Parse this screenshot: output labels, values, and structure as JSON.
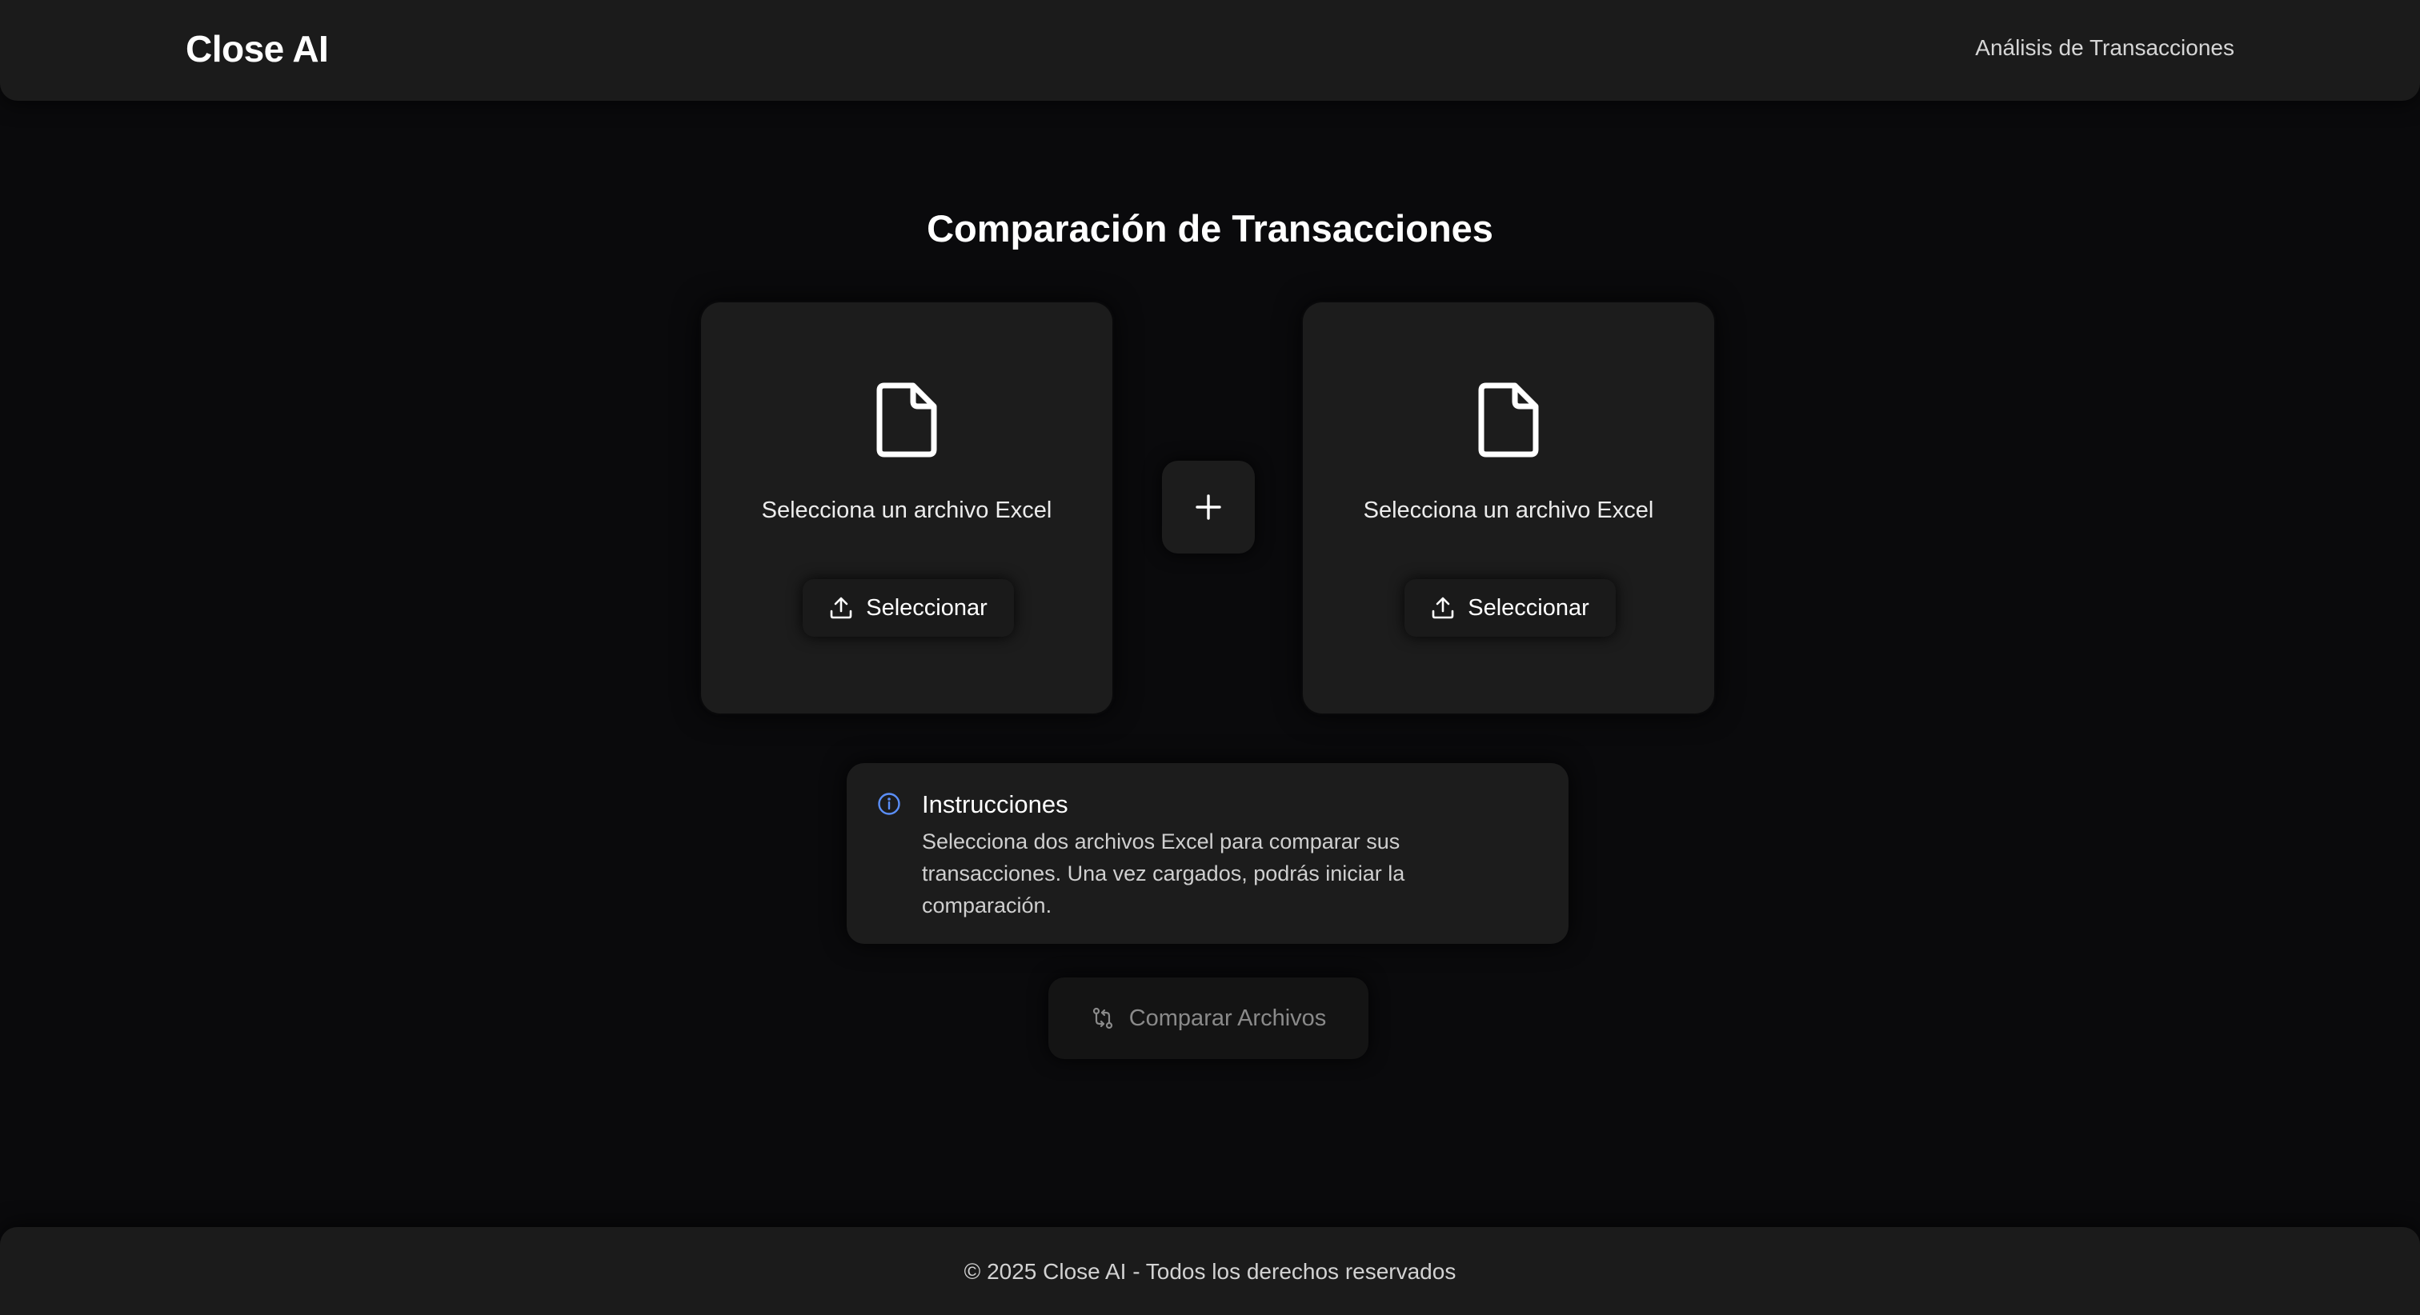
{
  "header": {
    "brand": "Close AI",
    "nav_link": "Análisis de Transacciones"
  },
  "main": {
    "title": "Comparación de Transacciones",
    "cards": [
      {
        "label": "Selecciona un archivo Excel",
        "button_label": "Seleccionar",
        "icon": "file-icon"
      },
      {
        "label": "Selecciona un archivo Excel",
        "button_label": "Seleccionar",
        "icon": "file-icon"
      }
    ],
    "plus_icon": "plus-icon",
    "instructions": {
      "title": "Instrucciones",
      "text": "Selecciona dos archivos Excel para comparar sus transacciones. Una vez cargados, podrás iniciar la comparación.",
      "icon": "info-icon",
      "icon_color": "#5b8ff9"
    },
    "compare_button": {
      "label": "Comparar Archivos",
      "icon": "compare-icon",
      "disabled": true
    }
  },
  "footer": {
    "text": "© 2025 Close AI - Todos los derechos reservados"
  },
  "colors": {
    "background": "#0a0a0c",
    "surface": "#1c1c1c",
    "text": "#ffffff",
    "muted_text": "#8a8a8a"
  }
}
